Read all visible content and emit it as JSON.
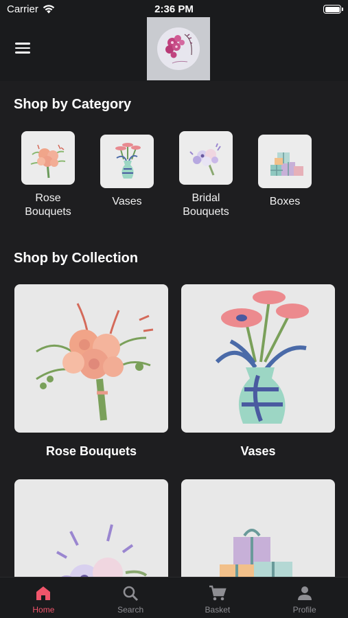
{
  "status": {
    "carrier": "Carrier",
    "time": "2:36 PM",
    "battery_level": 1.0
  },
  "header": {
    "menu_icon": "hamburger-icon",
    "logo_icon": "orchid-logo"
  },
  "sections": {
    "category_title": "Shop by Category",
    "collection_title": "Shop by Collection"
  },
  "categories": [
    {
      "label": "Rose\nBouquets",
      "icon": "rose-bouquet-image"
    },
    {
      "label": "Vases",
      "icon": "vase-image"
    },
    {
      "label": "Bridal\nBouquets",
      "icon": "bridal-bouquet-image"
    },
    {
      "label": "Boxes",
      "icon": "gift-boxes-image"
    }
  ],
  "collections": [
    {
      "label": "Rose Bouquets",
      "icon": "rose-bouquet-image"
    },
    {
      "label": "Vases",
      "icon": "vase-image"
    },
    {
      "label": "",
      "icon": "bridal-bouquet-image"
    },
    {
      "label": "",
      "icon": "gift-boxes-image"
    }
  ],
  "tabs": [
    {
      "label": "Home",
      "icon": "home-icon",
      "active": true
    },
    {
      "label": "Search",
      "icon": "search-icon",
      "active": false
    },
    {
      "label": "Basket",
      "icon": "cart-icon",
      "active": false
    },
    {
      "label": "Profile",
      "icon": "profile-icon",
      "active": false
    }
  ],
  "colors": {
    "accent": "#f0556b",
    "background": "#1e1e20",
    "bar": "#1a1b1d"
  }
}
